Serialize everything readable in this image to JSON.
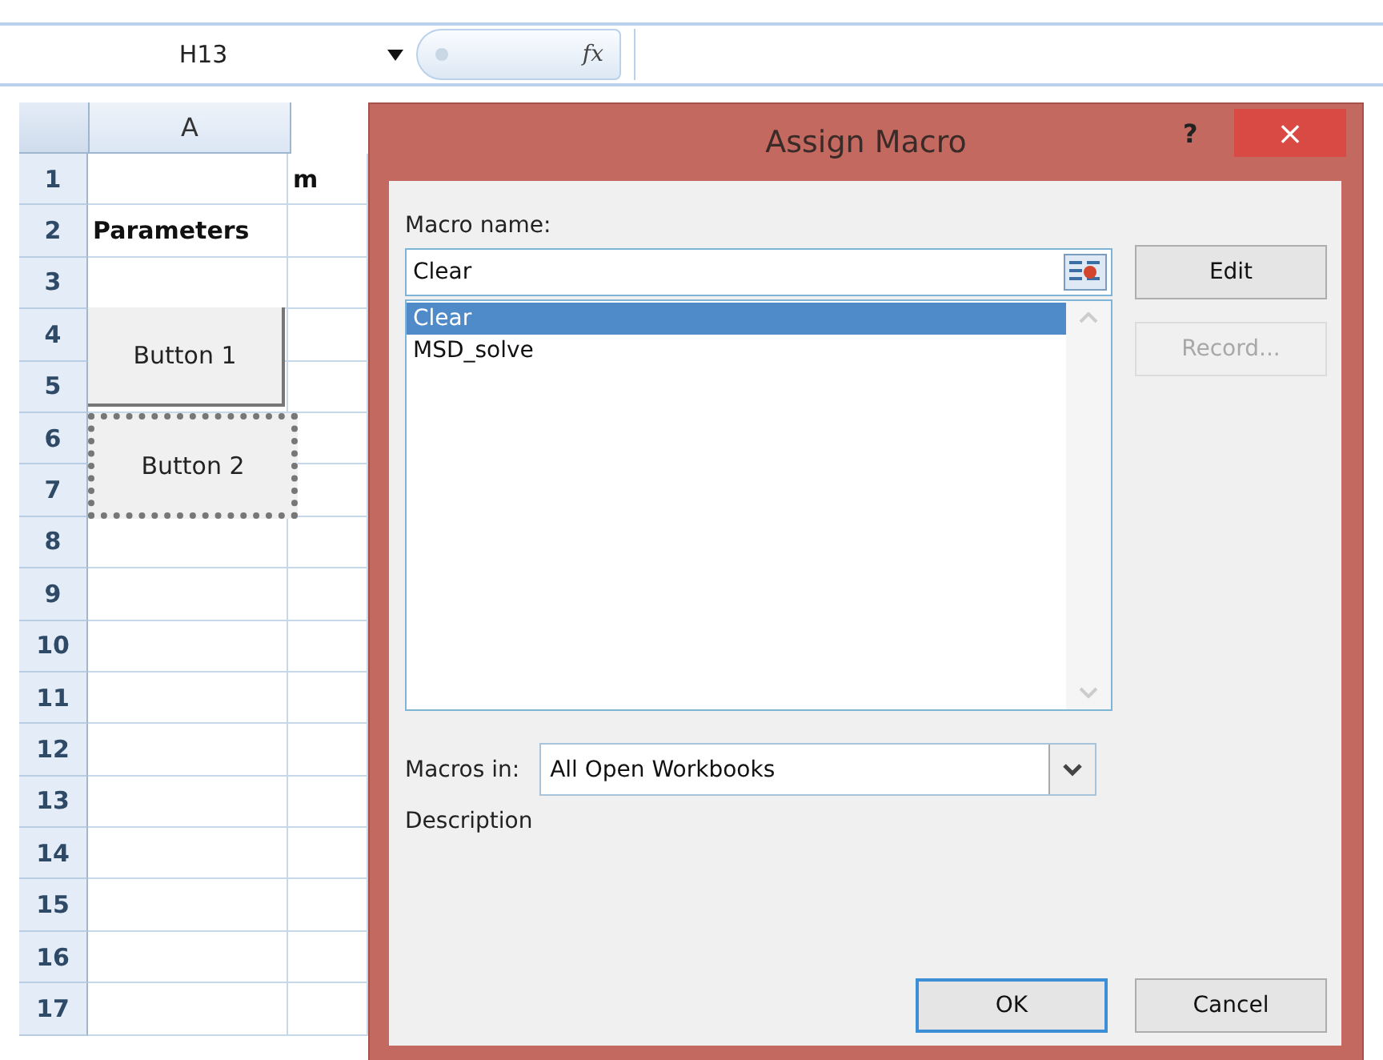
{
  "formula_bar": {
    "name_box": "H13",
    "formula_symbol": "fx"
  },
  "columns": [
    {
      "label": "A"
    }
  ],
  "rows": [
    {
      "number": "1",
      "cells": [
        "",
        "m"
      ]
    },
    {
      "number": "2",
      "cells": [
        "Parameters",
        ""
      ]
    },
    {
      "number": "3",
      "cells": [
        "",
        ""
      ]
    },
    {
      "number": "4",
      "cells": [
        "",
        ""
      ]
    },
    {
      "number": "5",
      "cells": [
        "",
        ""
      ]
    },
    {
      "number": "6",
      "cells": [
        "",
        ""
      ]
    },
    {
      "number": "7",
      "cells": [
        "",
        ""
      ]
    },
    {
      "number": "8",
      "cells": [
        "",
        ""
      ]
    },
    {
      "number": "9",
      "cells": [
        "",
        ""
      ]
    },
    {
      "number": "10",
      "cells": [
        "",
        ""
      ]
    },
    {
      "number": "11",
      "cells": [
        "",
        ""
      ]
    },
    {
      "number": "12",
      "cells": [
        "",
        ""
      ]
    },
    {
      "number": "13",
      "cells": [
        "",
        ""
      ]
    },
    {
      "number": "14",
      "cells": [
        "",
        ""
      ]
    },
    {
      "number": "15",
      "cells": [
        "",
        ""
      ]
    },
    {
      "number": "16",
      "cells": [
        "",
        ""
      ]
    },
    {
      "number": "17",
      "cells": [
        "",
        ""
      ]
    }
  ],
  "sheet_buttons": [
    {
      "label": "Button 1",
      "selected": false
    },
    {
      "label": "Button 2",
      "selected": true
    }
  ],
  "dialog": {
    "title": "Assign Macro",
    "help": "?",
    "close": "×",
    "macro_name_label": "Macro name:",
    "macro_name_value": "Clear",
    "macros": [
      {
        "name": "Clear",
        "selected": true
      },
      {
        "name": "MSD_solve",
        "selected": false
      }
    ],
    "side_buttons": [
      {
        "label": "Edit",
        "disabled": false
      },
      {
        "label": "Record...",
        "disabled": true
      }
    ],
    "macros_in_label": "Macros in:",
    "macros_in_value": "All Open Workbooks",
    "description_label": "Description",
    "footer_buttons": [
      {
        "label": "OK",
        "focused": true
      },
      {
        "label": "Cancel",
        "focused": false
      }
    ]
  }
}
